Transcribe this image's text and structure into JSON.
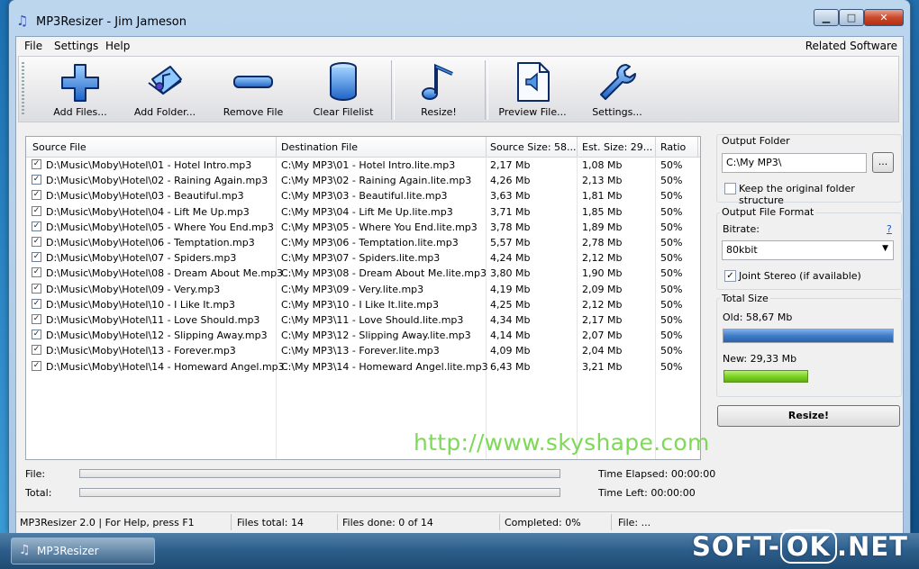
{
  "window": {
    "title": "MP3Resizer - Jim Jameson",
    "controls": {
      "minimize": "▁",
      "maximize": "□",
      "close": "✕"
    }
  },
  "menu": {
    "items": [
      "File",
      "Settings",
      "Help"
    ],
    "related": "Related Software"
  },
  "toolbar": {
    "add_files": "Add Files...",
    "add_folder": "Add Folder...",
    "remove_file": "Remove File",
    "clear_filelist": "Clear Filelist",
    "resize": "Resize!",
    "preview_file": "Preview File...",
    "settings": "Settings..."
  },
  "table": {
    "columns": [
      "Source File",
      "Destination File",
      "Source Size: 58...",
      "Est. Size: 29...",
      "Ratio"
    ],
    "rows": [
      [
        "D:\\Music\\Moby\\Hotel\\01 - Hotel Intro.mp3",
        "C:\\My MP3\\01 - Hotel Intro.lite.mp3",
        "2,17 Mb",
        "1,08 Mb",
        "50%"
      ],
      [
        "D:\\Music\\Moby\\Hotel\\02 - Raining Again.mp3",
        "C:\\My MP3\\02 - Raining Again.lite.mp3",
        "4,26 Mb",
        "2,13 Mb",
        "50%"
      ],
      [
        "D:\\Music\\Moby\\Hotel\\03 - Beautiful.mp3",
        "C:\\My MP3\\03 - Beautiful.lite.mp3",
        "3,63 Mb",
        "1,81 Mb",
        "50%"
      ],
      [
        "D:\\Music\\Moby\\Hotel\\04 - Lift Me Up.mp3",
        "C:\\My MP3\\04 - Lift Me Up.lite.mp3",
        "3,71 Mb",
        "1,85 Mb",
        "50%"
      ],
      [
        "D:\\Music\\Moby\\Hotel\\05 - Where You End.mp3",
        "C:\\My MP3\\05 - Where You End.lite.mp3",
        "3,78 Mb",
        "1,89 Mb",
        "50%"
      ],
      [
        "D:\\Music\\Moby\\Hotel\\06 - Temptation.mp3",
        "C:\\My MP3\\06 - Temptation.lite.mp3",
        "5,57 Mb",
        "2,78 Mb",
        "50%"
      ],
      [
        "D:\\Music\\Moby\\Hotel\\07 - Spiders.mp3",
        "C:\\My MP3\\07 - Spiders.lite.mp3",
        "4,24 Mb",
        "2,12 Mb",
        "50%"
      ],
      [
        "D:\\Music\\Moby\\Hotel\\08 - Dream About Me.mp3",
        "C:\\My MP3\\08 - Dream About Me.lite.mp3",
        "3,80 Mb",
        "1,90 Mb",
        "50%"
      ],
      [
        "D:\\Music\\Moby\\Hotel\\09 - Very.mp3",
        "C:\\My MP3\\09 - Very.lite.mp3",
        "4,19 Mb",
        "2,09 Mb",
        "50%"
      ],
      [
        "D:\\Music\\Moby\\Hotel\\10 - I Like It.mp3",
        "C:\\My MP3\\10 - I Like It.lite.mp3",
        "4,25 Mb",
        "2,12 Mb",
        "50%"
      ],
      [
        "D:\\Music\\Moby\\Hotel\\11 - Love Should.mp3",
        "C:\\My MP3\\11 - Love Should.lite.mp3",
        "4,34 Mb",
        "2,17 Mb",
        "50%"
      ],
      [
        "D:\\Music\\Moby\\Hotel\\12 - Slipping Away.mp3",
        "C:\\My MP3\\12 - Slipping Away.lite.mp3",
        "4,14 Mb",
        "2,07 Mb",
        "50%"
      ],
      [
        "D:\\Music\\Moby\\Hotel\\13 - Forever.mp3",
        "C:\\My MP3\\13 - Forever.lite.mp3",
        "4,09 Mb",
        "2,04 Mb",
        "50%"
      ],
      [
        "D:\\Music\\Moby\\Hotel\\14 - Homeward Angel.mp3",
        "C:\\My MP3\\14 - Homeward Angel.lite.mp3",
        "6,43 Mb",
        "3,21 Mb",
        "50%"
      ]
    ]
  },
  "watermark": "http://www.skyshape.com",
  "progress": {
    "file_label": "File:",
    "total_label": "Total:",
    "file_value": 0,
    "total_value": 0,
    "elapsed": "Time Elapsed: 00:00:00",
    "left": "Time Left: 00:00:00"
  },
  "status": {
    "help": "MP3Resizer 2.0 | For Help, press F1",
    "files_total": "Files total: 14",
    "files_done": "Files done: 0 of 14",
    "completed": "Completed: 0%",
    "file": "File: ..."
  },
  "output_folder": {
    "title": "Output Folder",
    "path": "C:\\My MP3\\",
    "browse": "...",
    "keep_structure": "Keep the original folder structure",
    "keep_structure_checked": false
  },
  "output_format": {
    "title": "Output File Format",
    "bitrate_label": "Bitrate:",
    "help": "?",
    "bitrate": "80kbit",
    "joint_stereo": "Joint Stereo (if available)",
    "joint_stereo_checked": true
  },
  "total_size": {
    "title": "Total Size",
    "old": "Old: 58,67 Mb",
    "new": "New: 29,33 Mb",
    "old_fraction": 1.0,
    "new_fraction": 0.5,
    "old_color": "#3f7cc7",
    "new_color": "#7ed321"
  },
  "resize_button": "Resize!",
  "taskbar": {
    "item": "MP3Resizer"
  },
  "brand": {
    "soft": "SOFT-",
    "ok": "OK",
    "net": ".NET"
  },
  "colors": {
    "accent": "#3a4fb8",
    "watermark": "#7ed957"
  }
}
